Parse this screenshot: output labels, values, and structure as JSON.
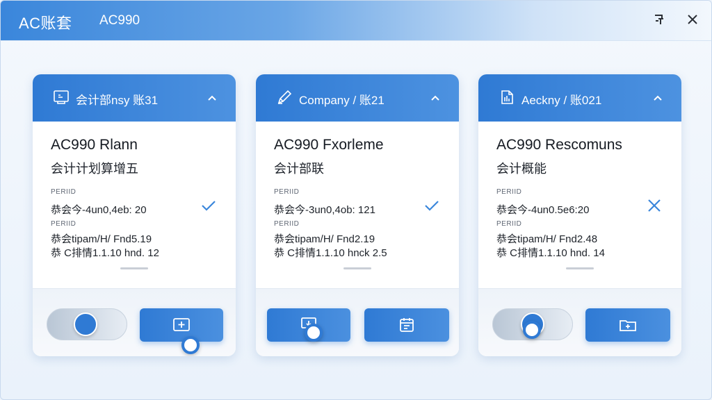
{
  "window": {
    "title": "AC账套",
    "subtitle": "AC990"
  },
  "titlebar_icons": {
    "pin": "pin-icon",
    "close": "close-icon"
  },
  "colors": {
    "accent": "#2f7ad4",
    "header_gradient_end": "#4d92e0",
    "check": "#3a86db",
    "cross": "#3a86db"
  },
  "cards": [
    {
      "header_label": "会计部nsy 账31",
      "header_icon": "monitor-icon",
      "title": "AC990 Rlann",
      "subtitle": "会计计划算增五",
      "label_1": "PERIID",
      "row_1": "恭会今-4un0,4eb: 20",
      "label_2": "PERIID",
      "row_2": "恭会tipam/H/ Fnd5.19",
      "row_3": "恭 C排情1.1.10 hnd. 12",
      "status_icon": "check-icon",
      "action_icon": "add-box-icon"
    },
    {
      "header_label": "Company / 账21",
      "header_icon": "pen-icon",
      "title": "AC990 Fxorleme",
      "subtitle": "会计部联",
      "label_1": "PERIID",
      "row_1": "恭会今-3un0,4ob: 121",
      "label_2": "PERIID",
      "row_2": "恭会tipam/H/ Fnd2.19",
      "row_3": "恭 C排情1.1.10 hnck 2.5",
      "status_icon": "check-icon",
      "action_1_icon": "screen-download-icon",
      "action_2_icon": "calendar-icon"
    },
    {
      "header_label": "Aeckny / 账021",
      "header_icon": "document-icon",
      "title": "AC990 Rescomuns",
      "subtitle": "会计概能",
      "label_1": "PERIID",
      "row_1": "恭会今-4un0.5e6:20",
      "label_2": "PERIID",
      "row_2": "恭会tipam/H/ Fnd2.48",
      "row_3": "恭 C排情1.1.10 hnd. 14",
      "status_icon": "cross-icon",
      "action_icon": "folder-plus-icon"
    }
  ],
  "toggles": {
    "card1_on": true,
    "card3_on": true
  }
}
